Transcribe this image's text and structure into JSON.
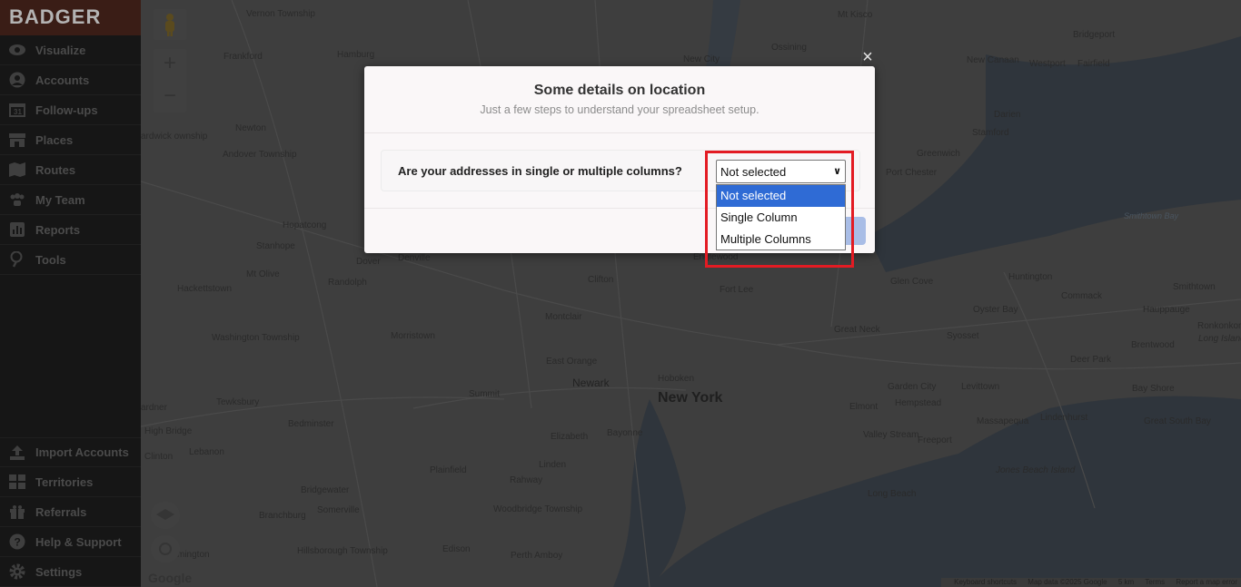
{
  "app": {
    "logo": "BADGER"
  },
  "sidebar": {
    "items": [
      {
        "label": "Visualize",
        "icon": "eye-icon"
      },
      {
        "label": "Accounts",
        "icon": "user-circle-icon"
      },
      {
        "label": "Follow-ups",
        "icon": "calendar-icon"
      },
      {
        "label": "Places",
        "icon": "store-icon"
      },
      {
        "label": "Routes",
        "icon": "map-icon"
      },
      {
        "label": "My Team",
        "icon": "team-icon"
      },
      {
        "label": "Reports",
        "icon": "chart-icon"
      },
      {
        "label": "Tools",
        "icon": "pin-icon"
      }
    ],
    "bottom_items": [
      {
        "label": "Import Accounts",
        "icon": "upload-icon"
      },
      {
        "label": "Territories",
        "icon": "grid-icon"
      },
      {
        "label": "Referrals",
        "icon": "gift-icon"
      },
      {
        "label": "Help & Support",
        "icon": "help-icon"
      },
      {
        "label": "Settings",
        "icon": "gear-icon"
      }
    ]
  },
  "map": {
    "zoom_in": "+",
    "zoom_out": "−",
    "labels": {
      "vernon": "Vernon Township",
      "frankford": "Frankford",
      "hamburg": "Hamburg",
      "mtkisco": "Mt Kisco",
      "ossining": "Ossining",
      "newcity": "New City",
      "bridgeport": "Bridgeport",
      "newcanaan": "New Canaan",
      "westport": "Westport",
      "fairfield": "Fairfield",
      "hardwick": "ardwick ownship",
      "newton": "Newton",
      "andover": "Andover Township",
      "darien": "Darien",
      "stamford": "Stamford",
      "greenwich": "Greenwich",
      "portchester": "Port Chester",
      "hopatcong": "Hopatcong",
      "stanhope": "Stanhope",
      "dover": "Dover",
      "denville": "Denville",
      "mtolive": "Mt Olive",
      "randolph": "Randolph",
      "hackettstown": "Hackettstown",
      "clifton": "Clifton",
      "fortlee": "Fort Lee",
      "englewood": "Englewood",
      "glencove": "Glen Cove",
      "huntington": "Huntington",
      "smithtown": "Smithtown",
      "commack": "Commack",
      "hauppauge": "Hauppauge",
      "ronkonkoma": "Ronkonkoma",
      "longisland": "Long Island",
      "oysterbay": "Oyster Bay",
      "washington": "Washington Township",
      "montclair": "Montclair",
      "morristown": "Morristown",
      "greatneck": "Great Neck",
      "syosset": "Syosset",
      "brentwood": "Brentwood",
      "deerpark": "Deer Park",
      "eastorange": "East Orange",
      "newark": "Newark",
      "hoboken": "Hoboken",
      "newyork": "New York",
      "summit": "Summit",
      "tewksbury": "Tewksbury",
      "gardencity": "Garden City",
      "levittown": "Levittown",
      "hempstead": "Hempstead",
      "elmont": "Elmont",
      "bayshore": "Bay Shore",
      "gardner": "ardner",
      "highbridge": "High Bridge",
      "bedminster": "Bedminster",
      "elizabeth": "Elizabeth",
      "bayonne": "Bayonne",
      "valleystream": "Valley Stream",
      "massapequa": "Massapequa",
      "lindenhurst": "Lindenhurst",
      "freeport": "Freeport",
      "clinton": "Clinton",
      "lebanon": "Lebanon",
      "plainfield": "Plainfield",
      "linden": "Linden",
      "rahway": "Rahway",
      "jonesbeach": "Jones Beach Island",
      "longbeach": "Long Beach",
      "greatsouthbay": "Great South Bay",
      "bridgewater": "Bridgewater",
      "branchburg": "Branchburg",
      "somerville": "Somerville",
      "woodbridge": "Woodbridge Township",
      "hillsborough": "Hillsborough Township",
      "edison": "Edison",
      "perthamboy": "Perth Amboy",
      "mington": "mington",
      "smithtownbay": "Smithtown Bay"
    },
    "footer": {
      "shortcuts": "Keyboard shortcuts",
      "mapdata": "Map data ©2025 Google",
      "scale": "5 km",
      "terms": "Terms",
      "report": "Report a map error"
    },
    "google": "Google"
  },
  "modal": {
    "title": "Some details on location",
    "subtitle": "Just a few steps to understand your spreadsheet setup.",
    "question": "Are your addresses in single or multiple columns?",
    "select_value": "Not selected",
    "options": [
      "Not selected",
      "Single Column",
      "Multiple Columns"
    ],
    "selected_index": 0,
    "close": "×"
  },
  "colors": {
    "highlight": "#e31b23",
    "option_selected": "#2f6bd5",
    "next_button": "#a9bde6"
  }
}
